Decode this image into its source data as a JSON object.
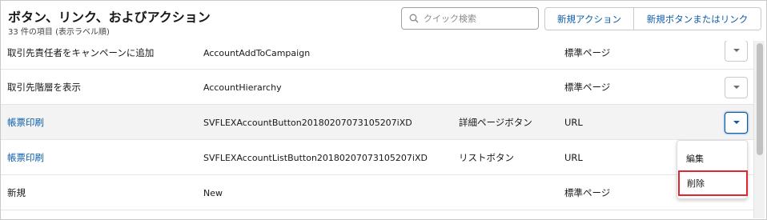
{
  "header": {
    "title": "ボタン、リンク、およびアクション",
    "subtitle": "33 件の項目 (表示ラベル順)",
    "search_placeholder": "クイック検索",
    "new_action_label": "新規アクション",
    "new_button_link_label": "新規ボタンまたはリンク"
  },
  "rows": [
    {
      "label": "取引先責任者をキャンペーンに追加",
      "name": "AccountAddToCampaign",
      "display": "",
      "type": "標準ページ",
      "is_link": false
    },
    {
      "label": "取引先階層を表示",
      "name": "AccountHierarchy",
      "display": "",
      "type": "標準ページ",
      "is_link": false
    },
    {
      "label": "帳票印刷",
      "name": "SVFLEXAccountButton20180207073105207iXD",
      "display": "詳細ページボタン",
      "type": "URL",
      "is_link": true
    },
    {
      "label": "帳票印刷",
      "name": "SVFLEXAccountListButton20180207073105207iXD",
      "display": "リストボタン",
      "type": "URL",
      "is_link": true
    },
    {
      "label": "新規",
      "name": "New",
      "display": "",
      "type": "標準ページ",
      "is_link": false
    }
  ],
  "row_menu": {
    "edit_label": "編集",
    "delete_label": "削除"
  },
  "colors": {
    "link": "#0b5cab",
    "highlight_row": "#f3f3f3",
    "delete_outline": "#e0262f"
  }
}
